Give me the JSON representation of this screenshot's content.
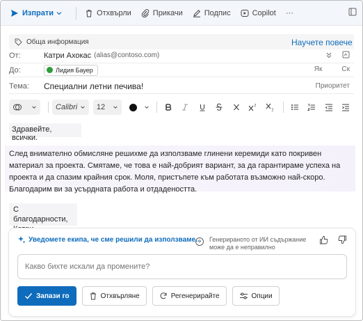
{
  "toolbar": {
    "send": "Изпрати",
    "discard": "Отхвърли",
    "attach": "Прикачи",
    "signature": "Подпис",
    "copilot": "Copilot",
    "more": "···"
  },
  "banner": {
    "text": "Обща информация",
    "learn_more": "Научете повече"
  },
  "header": {
    "from_label": "От:",
    "from_name": "Катри Ахокас",
    "from_email": "(alias@contoso.com)",
    "to_label": "До:",
    "to_recipient": "Лидия Бауер",
    "cc": "Як",
    "bcc": "Ск",
    "subject_label": "Тема:",
    "subject": "Специални летни печива!",
    "priority": "Приоритет"
  },
  "format": {
    "font": "Calibri",
    "size": "12"
  },
  "body": {
    "greeting": "Здравейте, всички.",
    "paragraph": [
      "След внимателно обмисляне решихме да използваме глинени керемиди като покривен",
      "материал за проекта. Смятаме, че това е най-добрият вариант, за да гарантираме успеха на",
      "проекта и да спазим крайния срок. Моля, пристъпете към работата възможно най-скоро.",
      "Благодарим ви за усърдната работа и отдадеността."
    ],
    "sign_line1": "С благодарности,",
    "sign_line2": "Катри"
  },
  "copilot": {
    "title": "Уведомете екипа, че сме решили да използваме...",
    "disclaimer_line1": "Генерираното от ИИ съдържание",
    "disclaimer_line2": "може да е неправилно",
    "placeholder": "Какво бихте искали да промените?",
    "keep": "Запази го",
    "discard": "Отхвърляне",
    "regenerate": "Регенерирайте",
    "options": "Опции"
  },
  "colors": {
    "accent": "#0f6cbd",
    "presence": "#2e9d3a"
  }
}
